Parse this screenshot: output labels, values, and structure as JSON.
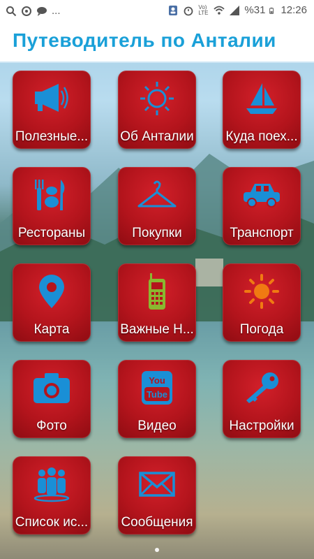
{
  "status_bar": {
    "left_icons": [
      "search-icon",
      "sync-icon",
      "chat-icon"
    ],
    "overflow": "...",
    "battery_percent": "%31",
    "network": "Vo) LTE",
    "time": "12:26"
  },
  "header": {
    "title": "Путеводитель по Анталии"
  },
  "tiles": [
    {
      "label": "Полезные...",
      "icon": "megaphone-icon"
    },
    {
      "label": "Об Анталии",
      "icon": "sun-outline-icon"
    },
    {
      "label": "Куда поех...",
      "icon": "sailboat-icon"
    },
    {
      "label": "Рестораны",
      "icon": "restaurant-icon"
    },
    {
      "label": "Покупки",
      "icon": "hanger-icon"
    },
    {
      "label": "Транспорт",
      "icon": "car-icon"
    },
    {
      "label": "Карта",
      "icon": "map-pin-icon"
    },
    {
      "label": "Важные Н...",
      "icon": "phone-icon"
    },
    {
      "label": "Погода",
      "icon": "sun-icon"
    },
    {
      "label": "Фото",
      "icon": "camera-icon"
    },
    {
      "label": "Видео",
      "icon": "youtube-icon"
    },
    {
      "label": "Настройки",
      "icon": "key-icon"
    },
    {
      "label": "Список ис...",
      "icon": "people-icon"
    },
    {
      "label": "Сообщения",
      "icon": "envelope-icon"
    }
  ],
  "colors": {
    "accent": "#1aa0d8",
    "tile_red": "#b3141c",
    "icon_blue": "#1a8fd6",
    "phone_green": "#8ab830",
    "sun_orange": "#f07a12"
  }
}
